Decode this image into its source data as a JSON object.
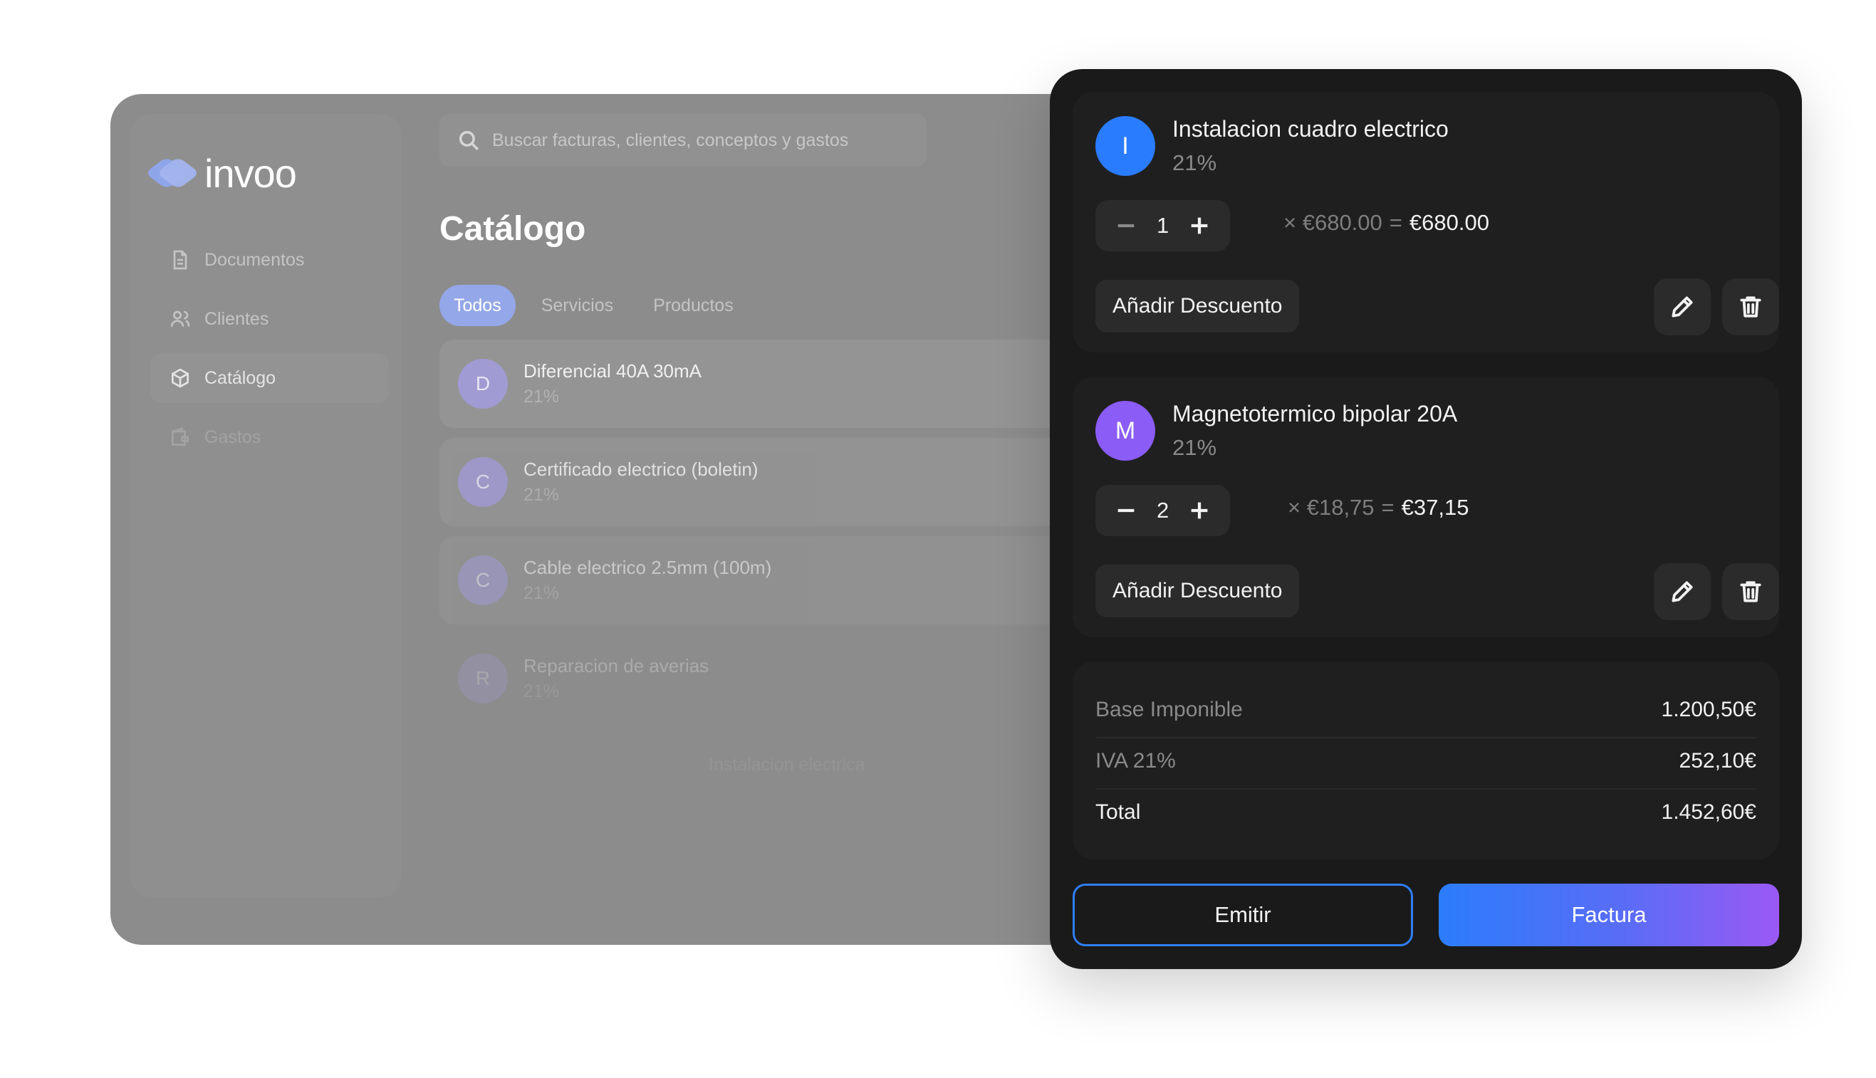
{
  "app": {
    "logo_text": "invoo",
    "search_placeholder": "Buscar facturas, clientes, conceptos y gastos",
    "nav": [
      {
        "label": "Documentos",
        "icon": "document-icon"
      },
      {
        "label": "Clientes",
        "icon": "users-icon"
      },
      {
        "label": "Catálogo",
        "icon": "box-icon"
      },
      {
        "label": "Gastos",
        "icon": "wallet-icon"
      }
    ],
    "page_title": "Catálogo",
    "filters": [
      "Todos",
      "Servicios",
      "Productos"
    ],
    "catalog_items": [
      {
        "initial": "D",
        "name": "Diferencial 40A 30mA",
        "tax": "21%"
      },
      {
        "initial": "C",
        "name": "Certificado electrico (boletin)",
        "tax": "21%"
      },
      {
        "initial": "C",
        "name": "Cable electrico 2.5mm (100m)",
        "tax": "21%"
      },
      {
        "initial": "R",
        "name": "Reparacion de averias",
        "tax": "21%"
      }
    ],
    "ghost_text": "Instalacion electrica"
  },
  "invoice": {
    "lines": [
      {
        "initial": "I",
        "name": "Instalacion cuadro electrico",
        "tax": "21%",
        "qty": "1",
        "unit": "× €680.00",
        "eq": "=",
        "result": "€680.00",
        "discount_label": "Añadir Descuento"
      },
      {
        "initial": "M",
        "name": "Magnetotermico bipolar 20A",
        "tax": "21%",
        "qty": "2",
        "unit": "× €18,75",
        "eq": "=",
        "result": "€37,15",
        "discount_label": "Añadir Descuento"
      }
    ],
    "totals": {
      "base_label": "Base Imponible",
      "base_value": "1.200,50€",
      "iva_label": "IVA 21%",
      "iva_value": "252,10€",
      "total_label": "Total",
      "total_value": "1.452,60€"
    },
    "buttons": {
      "emitir": "Emitir",
      "factura": "Factura"
    },
    "colors": {
      "accent_blue": "#2a7cff",
      "accent_purple": "#8b5cf6",
      "panel_bg": "#1a1a1a"
    }
  }
}
